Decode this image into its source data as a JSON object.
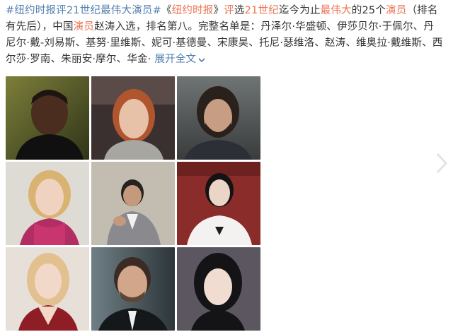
{
  "post": {
    "line1": {
      "hashtag": "#纽约时报评21世纪最伟大演员#",
      "a1": "《",
      "nyt": "纽约时报",
      "a2": "》",
      "w_ping": "评",
      "a3": "选",
      "w_21": "21世纪",
      "a4": "迄今为止",
      "w_great": "最伟大",
      "a5": "的25个",
      "w_actor": "演员",
      "a6": "（排名"
    },
    "line2": {
      "a1": "有先后），中国",
      "w_actor": "演员",
      "a2": "赵涛入选，排名第八。完整名单是：丹泽尔·华盛顿、伊莎贝尔·于佩尔、丹"
    },
    "line3": "尼尔·戴-刘易斯、基努·里维斯、妮可·基德曼、宋康昊、托尼·瑟维洛、赵涛、维奥拉·戴维斯、西",
    "line4": "尔莎·罗南、朱丽安·摩尔、华金·",
    "expand_label": "展开全文"
  },
  "photos": [
    {
      "id": "photo-1",
      "label": "actor photo 1"
    },
    {
      "id": "photo-2",
      "label": "actor photo 2"
    },
    {
      "id": "photo-3",
      "label": "actor photo 3"
    },
    {
      "id": "photo-4",
      "label": "actor photo 4"
    },
    {
      "id": "photo-5",
      "label": "actor photo 5"
    },
    {
      "id": "photo-6",
      "label": "actor photo 6"
    },
    {
      "id": "photo-7",
      "label": "actor photo 7"
    },
    {
      "id": "photo-8",
      "label": "actor photo 8"
    },
    {
      "id": "photo-9",
      "label": "actor photo 9"
    }
  ],
  "colors": {
    "text": "#333333",
    "highlight": "#eb7350",
    "link": "#507daf",
    "background": "#ffffff"
  },
  "icons": {
    "expand": "chevron-down-icon",
    "next": "chevron-right-icon"
  }
}
